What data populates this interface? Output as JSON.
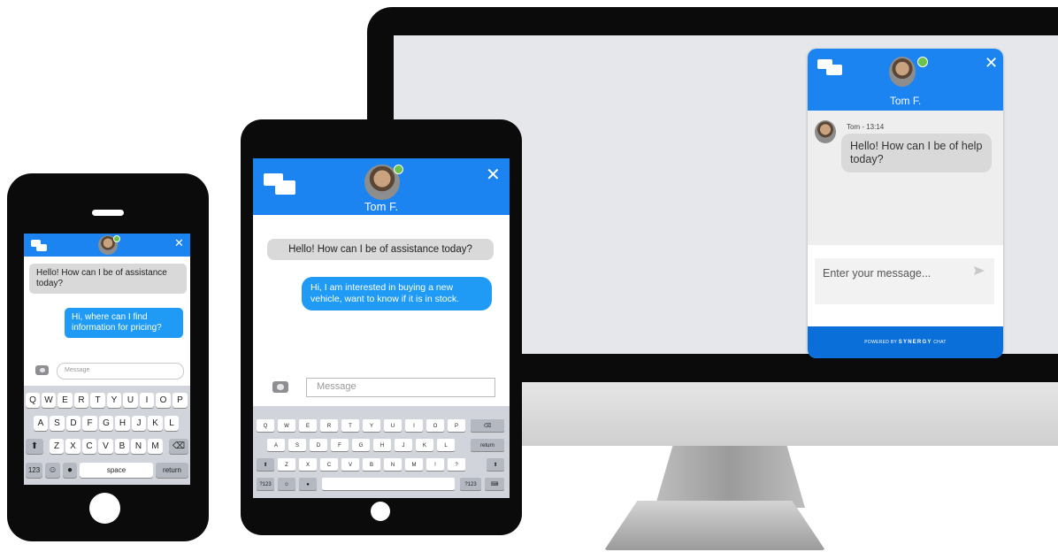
{
  "desktop": {
    "agent_name": "Tom F.",
    "message_meta": "Tom - 13:14",
    "message": "Hello! How can I be of help today?",
    "input_placeholder": "Enter your message...",
    "powered_prefix": "POWERED BY",
    "powered_brand": "SYNERGY",
    "powered_suffix": "CHAT",
    "accent_color": "#1b84f0"
  },
  "tablet": {
    "agent_name": "Tom F.",
    "incoming_message": "Hello! How can I be of assistance today?",
    "outgoing_message": "Hi, I am interested in  buying a new vehicle, want to know if it is in stock.",
    "input_placeholder": "Message",
    "keyboard_rows": [
      [
        "Q",
        "W",
        "E",
        "R",
        "T",
        "Y",
        "U",
        "I",
        "O",
        "P"
      ],
      [
        "A",
        "S",
        "D",
        "F",
        "G",
        "H",
        "J",
        "K",
        "L"
      ],
      [
        "Z",
        "X",
        "C",
        "V",
        "B",
        "N",
        "M",
        "!",
        "?"
      ]
    ],
    "keys": {
      "return": "return",
      "numbers": "?123"
    }
  },
  "phone": {
    "incoming_message": "Hello! How can I be of assistance today?",
    "outgoing_message": "Hi, where can I find information for pricing?",
    "input_placeholder": "Message",
    "keyboard_rows": [
      [
        "Q",
        "W",
        "E",
        "R",
        "T",
        "Y",
        "U",
        "I",
        "O",
        "P"
      ],
      [
        "A",
        "S",
        "D",
        "F",
        "G",
        "H",
        "J",
        "K",
        "L"
      ],
      [
        "Z",
        "X",
        "C",
        "V",
        "B",
        "N",
        "M"
      ]
    ],
    "keys": {
      "numbers": "123",
      "space": "space",
      "return": "return"
    }
  },
  "icons": {
    "chat": "chat-bubbles-icon",
    "close": "close-icon",
    "send": "send-icon",
    "camera": "camera-icon",
    "shift": "shift-icon",
    "backspace": "backspace-icon",
    "emoji": "emoji-icon",
    "mic": "microphone-icon"
  }
}
